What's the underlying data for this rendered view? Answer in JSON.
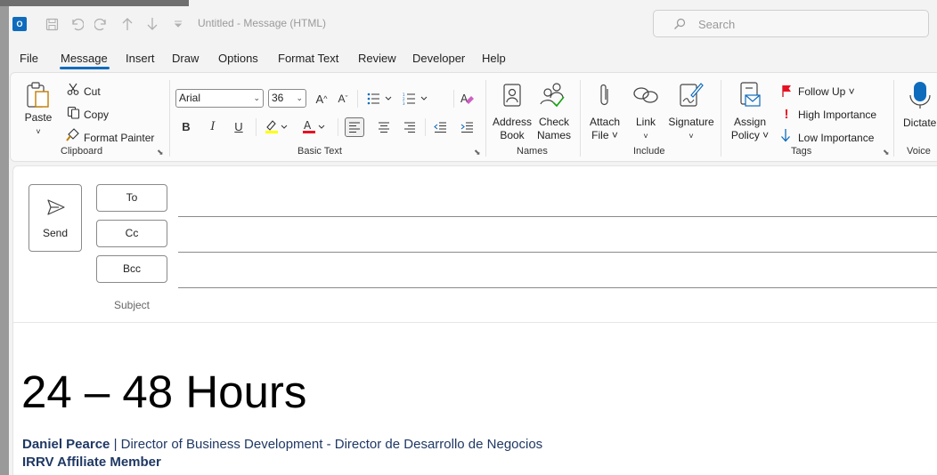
{
  "titlebar": {
    "app_icon_letter": "O",
    "title": "Untitled  -  Message (HTML)",
    "search_placeholder": "Search",
    "quick_access": [
      "save-icon",
      "undo-icon",
      "redo-icon",
      "up-arrow-icon",
      "down-arrow-icon",
      "customize-icon"
    ]
  },
  "menu": {
    "items": [
      "File",
      "Message",
      "Insert",
      "Draw",
      "Options",
      "Format Text",
      "Review",
      "Developer",
      "Help"
    ],
    "active": "Message"
  },
  "ribbon": {
    "clipboard": {
      "label": "Clipboard",
      "paste": "Paste",
      "cut": "Cut",
      "copy": "Copy",
      "format_painter": "Format Painter"
    },
    "basic_text": {
      "label": "Basic Text",
      "font": "Arial",
      "size": "36",
      "bold": "B",
      "italic": "I",
      "underline": "U",
      "grow": "A^",
      "shrink": "Aˇ"
    },
    "names": {
      "label": "Names",
      "address_book_1": "Address",
      "address_book_2": "Book",
      "check_names_1": "Check",
      "check_names_2": "Names"
    },
    "include": {
      "label": "Include",
      "attach_1": "Attach",
      "attach_2": "File ˅",
      "link": "Link",
      "signature": "Signature"
    },
    "tags": {
      "label": "Tags",
      "assign_1": "Assign",
      "assign_2": "Policy ˅",
      "follow_up": "Follow Up ˅",
      "high_importance": "High Importance",
      "low_importance": "Low Importance"
    },
    "voice": {
      "label": "Voice",
      "dictate": "Dictate"
    },
    "colors": {
      "highlight": "#ffff00",
      "font_color": "#e81123",
      "accent": "#0f6cbd"
    }
  },
  "compose": {
    "send": "Send",
    "to": "To",
    "cc": "Cc",
    "bcc": "Bcc",
    "subject_label": "Subject",
    "body_heading": "24 – 48 Hours",
    "signature": {
      "name": "Daniel Pearce",
      "separator": " | ",
      "title": "Director of Business Development - Director de Desarrollo de Negocios",
      "membership": "IRRV Affiliate Member"
    }
  }
}
